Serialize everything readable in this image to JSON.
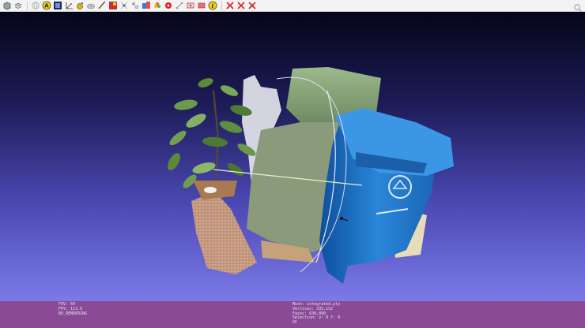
{
  "toolbar": {
    "icons": [
      "cube-icon",
      "layers-icon",
      "globe-icon",
      "label-a-icon",
      "selection-icon",
      "axis-icon",
      "measure-icon",
      "mesh-icon",
      "brush-icon",
      "paint-icon",
      "align-icon",
      "move-icon",
      "color-icon",
      "flower-icon",
      "red-points-icon",
      "transform-icon",
      "select-points-icon",
      "select-faces-icon",
      "info-icon",
      "delete-icon",
      "delete-vertices-icon",
      "delete-faces-icon"
    ],
    "search_icon": "search-icon"
  },
  "status": {
    "left": {
      "fov": "FOV: 60",
      "fps": "FPS:   113.6",
      "mode": "BO_RENDERING"
    },
    "right": {
      "mesh": "Mesh: integrated.ply",
      "vertices": "Vertices: 335,152",
      "faces": "Faces: 630,890",
      "selection": "Selection: v: 0 f: 0",
      "vc": "VC"
    }
  },
  "colors": {
    "status_bar": "#8a4a96",
    "viewport_top": "#05051a",
    "viewport_bottom": "#7b7ae8",
    "bin_blue": "#1f74c6"
  }
}
